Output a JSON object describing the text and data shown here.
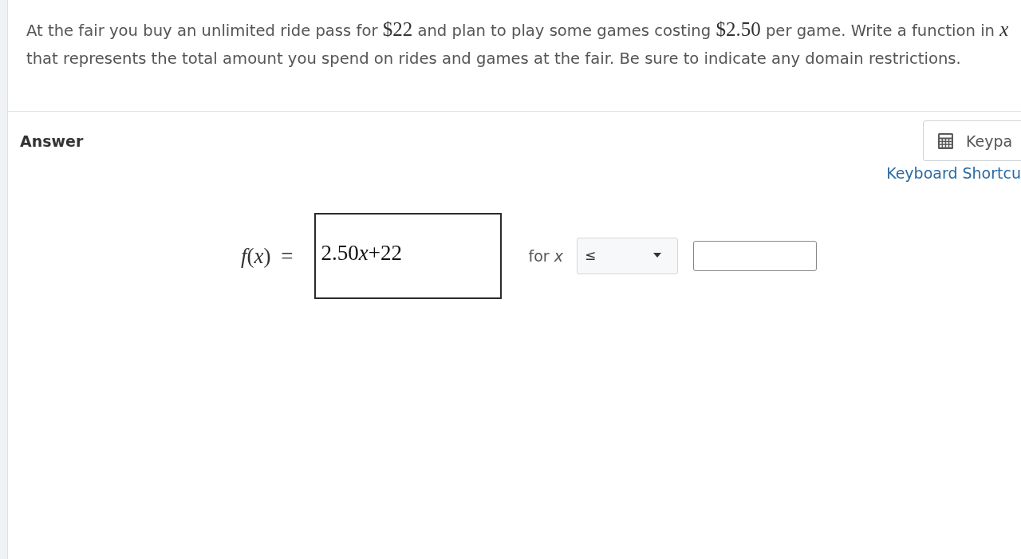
{
  "question": {
    "segments": [
      {
        "kind": "text",
        "text": "At the fair you buy an unlimited ride pass for "
      },
      {
        "kind": "math",
        "text": "$22"
      },
      {
        "kind": "text",
        "text": " and plan to play some games costing "
      },
      {
        "kind": "math",
        "text": "$2.50"
      },
      {
        "kind": "text",
        "text": " per game. Write a function in "
      },
      {
        "kind": "variable",
        "text": "x"
      },
      {
        "kind": "text",
        "text": " that represents the total amount you spend on rides and games at the fair. Be sure to indicate any domain restrictions."
      }
    ]
  },
  "answer": {
    "heading": "Answer",
    "keypad_button": {
      "label": "Keypa"
    },
    "shortcuts_link": {
      "label": "Keyboard Shortcu"
    },
    "function_label": "*f*(*x*) =",
    "function_value": [
      {
        "kind": "number",
        "text": "2.50"
      },
      {
        "kind": "variable",
        "text": "x"
      },
      {
        "kind": "number",
        "text": "+22"
      }
    ],
    "condition_label": "for *x*",
    "comparison_select": {
      "value": "≤"
    }
  }
}
